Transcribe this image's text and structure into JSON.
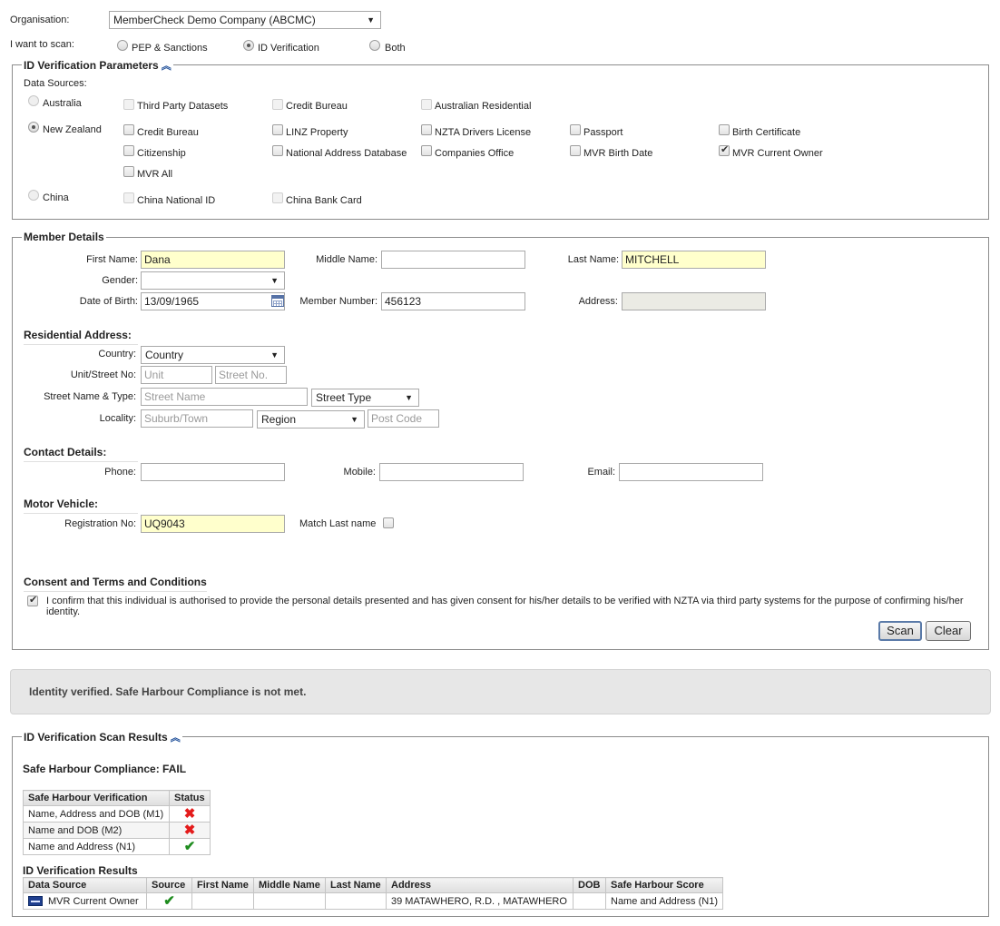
{
  "organisation": {
    "label": "Organisation:",
    "value": "MemberCheck Demo Company (ABCMC)"
  },
  "scan": {
    "label": "I want to scan:",
    "options": [
      "PEP & Sanctions",
      "ID Verification",
      "Both"
    ],
    "selected": "ID Verification"
  },
  "params": {
    "legend": "ID Verification Parameters",
    "data_sources_label": "Data Sources:",
    "countries": [
      {
        "name": "Australia",
        "selected": false,
        "sources": [
          "Third Party Datasets",
          "Credit Bureau",
          "Australian Residential"
        ]
      },
      {
        "name": "New Zealand",
        "selected": true,
        "sources": [
          "Credit Bureau",
          "LINZ Property",
          "NZTA Drivers License",
          "Passport",
          "Birth Certificate",
          "Citizenship",
          "National Address Database",
          "Companies Office",
          "MVR Birth Date",
          "MVR Current Owner",
          "MVR All"
        ],
        "checked": [
          "MVR Current Owner"
        ]
      },
      {
        "name": "China",
        "selected": false,
        "sources": [
          "China National ID",
          "China Bank Card"
        ]
      }
    ]
  },
  "member": {
    "legend": "Member Details",
    "first_name_label": "First Name:",
    "first_name": "Dana",
    "middle_name_label": "Middle Name:",
    "middle_name": "",
    "last_name_label": "Last Name:",
    "last_name": "MITCHELL",
    "gender_label": "Gender:",
    "gender": "",
    "dob_label": "Date of Birth:",
    "dob": "13/09/1965",
    "member_number_label": "Member Number:",
    "member_number": "456123",
    "address_label": "Address:",
    "address": ""
  },
  "residential": {
    "heading": "Residential Address:",
    "country_label": "Country:",
    "country": "Country",
    "unit_street_label": "Unit/Street No:",
    "unit_placeholder": "Unit",
    "street_no_placeholder": "Street No.",
    "street_name_type_label": "Street Name & Type:",
    "street_name_placeholder": "Street Name",
    "street_type": "Street Type",
    "locality_label": "Locality:",
    "suburb_placeholder": "Suburb/Town",
    "region": "Region",
    "post_code_placeholder": "Post Code"
  },
  "contact": {
    "heading": "Contact Details:",
    "phone_label": "Phone:",
    "mobile_label": "Mobile:",
    "email_label": "Email:"
  },
  "motor": {
    "heading": "Motor Vehicle:",
    "registration_label": "Registration No:",
    "registration": "UQ9043",
    "match_last_name_label": "Match Last name"
  },
  "consent": {
    "heading": "Consent and Terms and Conditions",
    "text": "I confirm that this individual is authorised to provide the personal details presented and has given consent for his/her details to be verified with NZTA via third party systems for the purpose of confirming his/her identity.",
    "checked": true
  },
  "buttons": {
    "scan": "Scan",
    "clear": "Clear"
  },
  "banner": {
    "message": "Identity verified. Safe Harbour Compliance is not met."
  },
  "results": {
    "legend": "ID Verification Scan Results",
    "compliance": "Safe Harbour Compliance: FAIL",
    "safe_harbour": {
      "headers": [
        "Safe Harbour Verification",
        "Status"
      ],
      "rows": [
        {
          "name": "Name, Address and DOB (M1)",
          "status": "fail"
        },
        {
          "name": "Name and DOB (M2)",
          "status": "fail"
        },
        {
          "name": "Name and Address (N1)",
          "status": "pass"
        }
      ]
    },
    "idv_heading": "ID Verification Results",
    "idv": {
      "headers": [
        "Data Source",
        "Source",
        "First Name",
        "Middle Name",
        "Last Name",
        "Address",
        "DOB",
        "Safe Harbour Score"
      ],
      "rows": [
        {
          "data_source": "MVR Current Owner",
          "source": "pass",
          "first_name": "",
          "middle_name": "",
          "last_name": "",
          "address": "39 MATAWHERO, R.D. , MATAWHERO",
          "dob": "",
          "score": "Name and Address (N1)"
        }
      ]
    }
  }
}
